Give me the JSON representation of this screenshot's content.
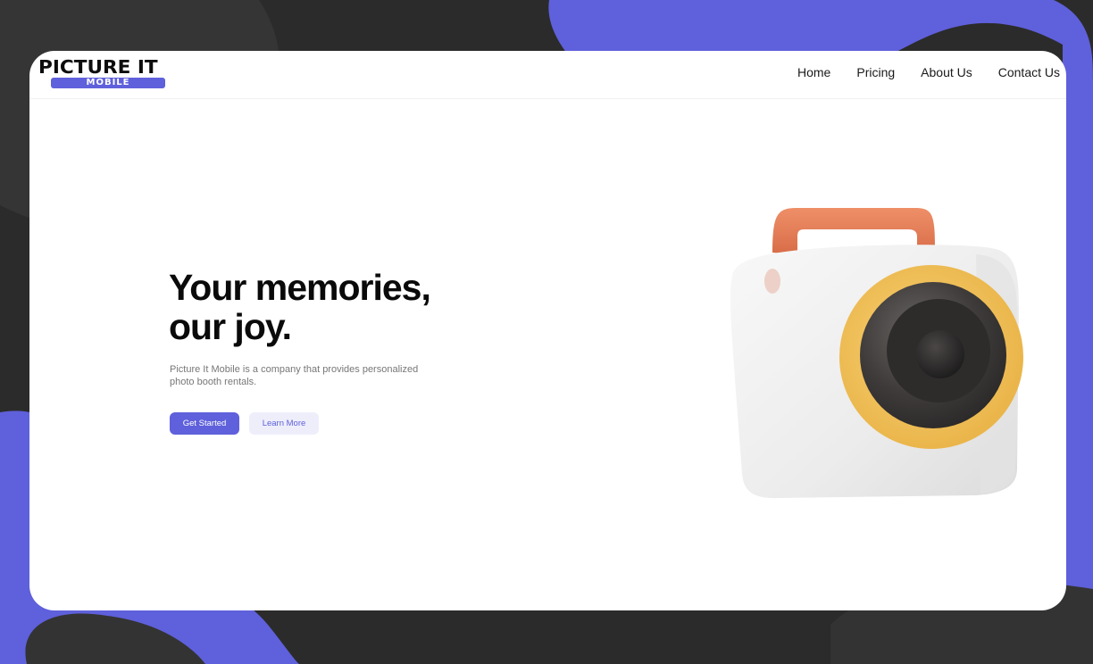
{
  "logo": {
    "main": "PICTURE IT",
    "sub": "MOBILE"
  },
  "nav": {
    "home": "Home",
    "pricing": "Pricing",
    "about": "About Us",
    "contact": "Contact Us"
  },
  "hero": {
    "title_line1": "Your memories,",
    "title_line2": "our joy.",
    "description": "Picture It Mobile is a company that provides personalized photo booth rentals.",
    "primary_button": "Get Started",
    "secondary_button": "Learn More"
  },
  "colors": {
    "accent": "#5f60db",
    "background": "#2b2b2b",
    "camera_handle": "#e07a55",
    "lens_ring": "#f2c35b"
  }
}
